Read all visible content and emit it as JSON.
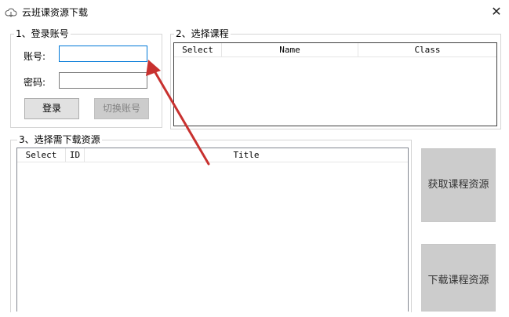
{
  "window": {
    "title": "云班课资源下载",
    "app_icon": "cloud-icon",
    "close_glyph": "✕"
  },
  "login_group": {
    "label": "1、登录账号",
    "account_label": "账号:",
    "account_value": "",
    "password_label": "密码:",
    "password_value": "",
    "login_button": "登录",
    "switch_button": "切换账号"
  },
  "course_group": {
    "label": "2、选择课程",
    "columns": [
      "Select",
      "Name",
      "Class"
    ]
  },
  "resource_group": {
    "label": "3、选择需下载资源",
    "columns": [
      "Select",
      "ID",
      "Title"
    ]
  },
  "actions": {
    "fetch_button": "获取课程资源",
    "download_button": "下载课程资源"
  },
  "annotation": {
    "arrow_color": "#c8312f"
  }
}
